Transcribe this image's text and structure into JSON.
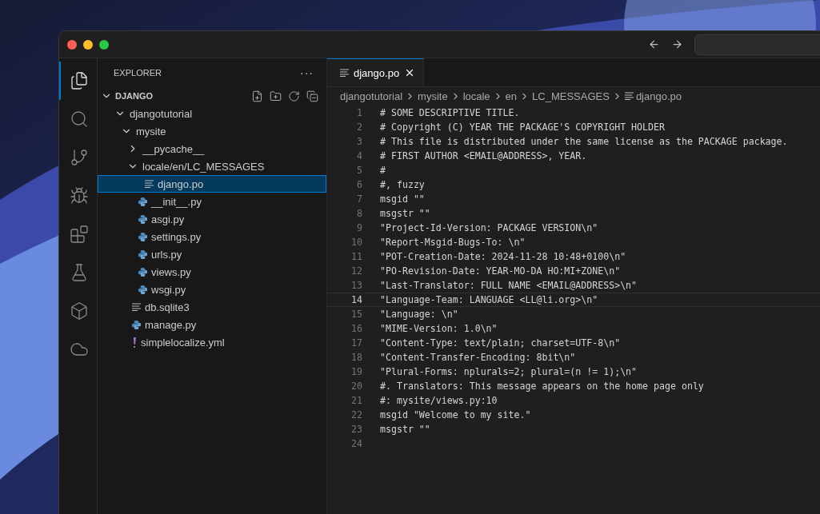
{
  "activity_bar": [
    {
      "kind": "files",
      "selected": true
    },
    {
      "kind": "search",
      "selected": false
    },
    {
      "kind": "source-control",
      "selected": false
    },
    {
      "kind": "run-debug",
      "selected": false
    },
    {
      "kind": "extensions",
      "selected": false
    },
    {
      "kind": "testing",
      "selected": false
    },
    {
      "kind": "box",
      "selected": false
    },
    {
      "kind": "cloud",
      "selected": false
    }
  ],
  "explorer": {
    "title": "EXPLORER",
    "more": "···",
    "root": {
      "label": "DJANGO",
      "expanded": true
    },
    "tree": [
      {
        "label": "djangotutorial",
        "kind": "folder",
        "expanded": true,
        "selected": false,
        "children": [
          {
            "label": "mysite",
            "kind": "folder",
            "expanded": true,
            "selected": false,
            "children": [
              {
                "label": "__pycache__",
                "kind": "folder",
                "expanded": false,
                "selected": false
              },
              {
                "label": "locale/en/LC_MESSAGES",
                "kind": "folder",
                "expanded": true,
                "selected": false,
                "children": [
                  {
                    "label": "django.po",
                    "kind": "text",
                    "selected": true
                  }
                ]
              },
              {
                "label": "__init__.py",
                "kind": "python",
                "selected": false
              },
              {
                "label": "asgi.py",
                "kind": "python",
                "selected": false
              },
              {
                "label": "settings.py",
                "kind": "python",
                "selected": false
              },
              {
                "label": "urls.py",
                "kind": "python",
                "selected": false
              },
              {
                "label": "views.py",
                "kind": "python",
                "selected": false
              },
              {
                "label": "wsgi.py",
                "kind": "python",
                "selected": false
              }
            ]
          },
          {
            "label": "db.sqlite3",
            "kind": "text",
            "selected": false
          },
          {
            "label": "manage.py",
            "kind": "python",
            "selected": false
          },
          {
            "label": "simplelocalize.yml",
            "kind": "yaml",
            "selected": false
          }
        ]
      }
    ]
  },
  "tabs": [
    {
      "label": "django.po",
      "selected": true
    }
  ],
  "breadcrumbs": [
    "djangotutorial",
    "mysite",
    "locale",
    "en",
    "LC_MESSAGES",
    "django.po"
  ],
  "editor": {
    "lines": [
      {
        "number": "1",
        "text": "# SOME DESCRIPTIVE TITLE.",
        "current": false
      },
      {
        "number": "2",
        "text": "# Copyright (C) YEAR THE PACKAGE'S COPYRIGHT HOLDER",
        "current": false
      },
      {
        "number": "3",
        "text": "# This file is distributed under the same license as the PACKAGE package.",
        "current": false
      },
      {
        "number": "4",
        "text": "# FIRST AUTHOR <EMAIL@ADDRESS>, YEAR.",
        "current": false
      },
      {
        "number": "5",
        "text": "#",
        "current": false
      },
      {
        "number": "6",
        "text": "#, fuzzy",
        "current": false
      },
      {
        "number": "7",
        "text": "msgid \"\"",
        "current": false
      },
      {
        "number": "8",
        "text": "msgstr \"\"",
        "current": false
      },
      {
        "number": "9",
        "text": "\"Project-Id-Version: PACKAGE VERSION\\n\"",
        "current": false
      },
      {
        "number": "10",
        "text": "\"Report-Msgid-Bugs-To: \\n\"",
        "current": false
      },
      {
        "number": "11",
        "text": "\"POT-Creation-Date: 2024-11-28 10:48+0100\\n\"",
        "current": false
      },
      {
        "number": "12",
        "text": "\"PO-Revision-Date: YEAR-MO-DA HO:MI+ZONE\\n\"",
        "current": false
      },
      {
        "number": "13",
        "text": "\"Last-Translator: FULL NAME <EMAIL@ADDRESS>\\n\"",
        "current": false
      },
      {
        "number": "14",
        "text": "\"Language-Team: LANGUAGE <LL@li.org>\\n\"",
        "current": true
      },
      {
        "number": "15",
        "text": "\"Language: \\n\"",
        "current": false
      },
      {
        "number": "16",
        "text": "\"MIME-Version: 1.0\\n\"",
        "current": false
      },
      {
        "number": "17",
        "text": "\"Content-Type: text/plain; charset=UTF-8\\n\"",
        "current": false
      },
      {
        "number": "18",
        "text": "\"Content-Transfer-Encoding: 8bit\\n\"",
        "current": false
      },
      {
        "number": "19",
        "text": "\"Plural-Forms: nplurals=2; plural=(n != 1);\\n\"",
        "current": false
      },
      {
        "number": "20",
        "text": "#. Translators: This message appears on the home page only",
        "current": false
      },
      {
        "number": "21",
        "text": "#: mysite/views.py:10",
        "current": false
      },
      {
        "number": "22",
        "text": "msgid \"Welcome to my site.\"",
        "current": false
      },
      {
        "number": "23",
        "text": "msgstr \"\"",
        "current": false
      },
      {
        "number": "24",
        "current": false
      }
    ]
  }
}
